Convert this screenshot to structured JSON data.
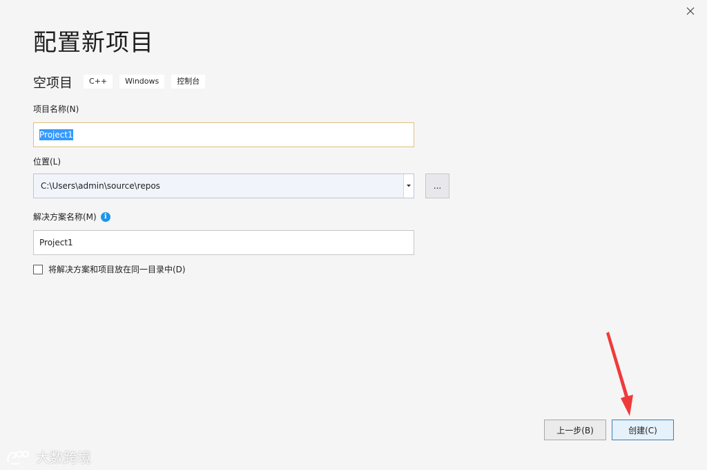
{
  "window": {
    "title": "配置新项目"
  },
  "template": {
    "name": "空项目",
    "tags": [
      "C++",
      "Windows",
      "控制台"
    ]
  },
  "fields": {
    "project_name": {
      "label": "项目名称(N)",
      "value": "Project1"
    },
    "location": {
      "label": "位置(L)",
      "value": "C:\\Users\\admin\\source\\repos",
      "browse_label": "..."
    },
    "solution_name": {
      "label": "解决方案名称(M)",
      "value": "Project1",
      "info_icon": "i"
    }
  },
  "checkbox": {
    "label": "将解决方案和项目放在同一目录中(D)",
    "checked": false
  },
  "buttons": {
    "back_label": "上一步(B)",
    "create_label": "创建(C)"
  },
  "watermark": {
    "text": "大数跨境"
  },
  "colors": {
    "accent": "#3399ff",
    "info": "#1c97ea",
    "annotation_arrow": "#f03a3a"
  }
}
